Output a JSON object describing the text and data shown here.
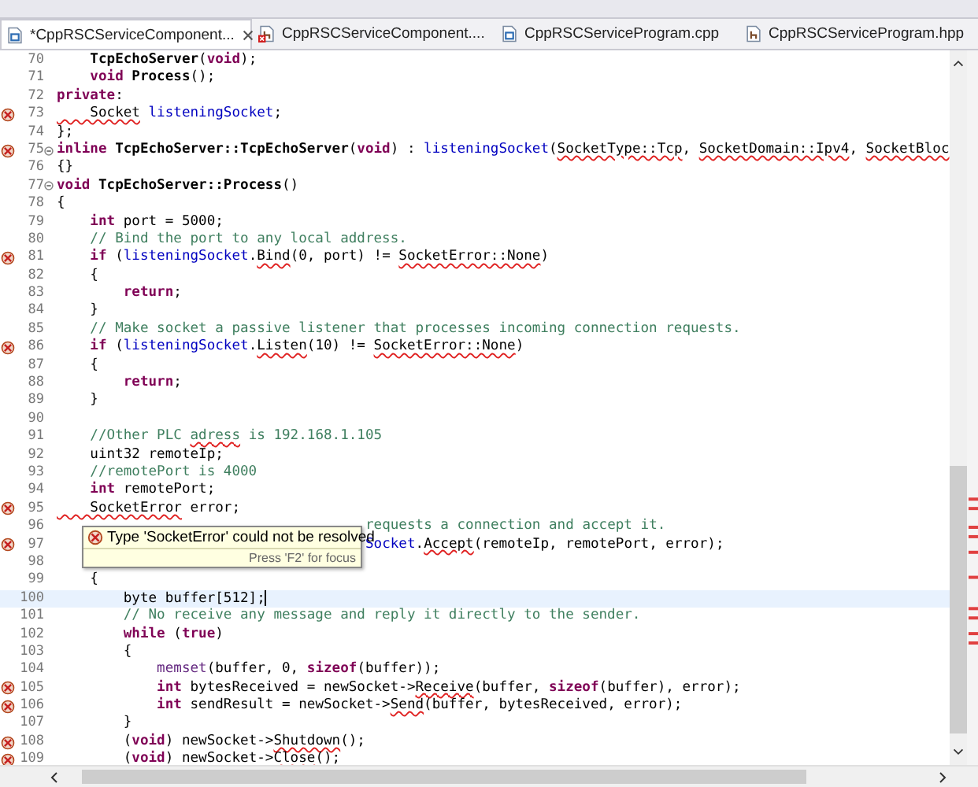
{
  "tabs": [
    {
      "label": "*CppRSCServiceComponent...",
      "kind": "source",
      "error": false,
      "selected": true,
      "closable": true
    },
    {
      "label": "CppRSCServiceComponent....",
      "kind": "header",
      "error": true,
      "selected": false,
      "closable": false
    },
    {
      "label": "CppRSCServiceProgram.cpp",
      "kind": "source",
      "error": false,
      "selected": false,
      "closable": false
    },
    {
      "label": "CppRSCServiceProgram.hpp",
      "kind": "header",
      "error": false,
      "selected": false,
      "closable": false
    }
  ],
  "lines": [
    {
      "number": "70",
      "problem": false,
      "foldable": false,
      "current": false,
      "segments": [
        {
          "text": "    TcpEchoServer",
          "kind": "decl"
        },
        {
          "text": "(",
          "kind": "plain"
        },
        {
          "text": "void",
          "kind": "kw"
        },
        {
          "text": ");",
          "kind": "plain"
        }
      ]
    },
    {
      "number": "71",
      "problem": false,
      "foldable": false,
      "current": false,
      "segments": [
        {
          "text": "    void",
          "kind": "kw"
        },
        {
          "text": " Process",
          "kind": "decl"
        },
        {
          "text": "();",
          "kind": "plain"
        }
      ]
    },
    {
      "number": "72",
      "problem": false,
      "foldable": false,
      "current": false,
      "segments": [
        {
          "text": "private",
          "kind": "kw"
        },
        {
          "text": ":",
          "kind": "plain"
        }
      ]
    },
    {
      "number": "73",
      "problem": true,
      "foldable": false,
      "current": false,
      "segments": [
        {
          "text": "    Socket",
          "kind": "unresolved"
        },
        {
          "text": " listeningSocket",
          "kind": "field"
        },
        {
          "text": ";",
          "kind": "plain"
        }
      ]
    },
    {
      "number": "74",
      "problem": false,
      "foldable": false,
      "current": false,
      "segments": [
        {
          "text": "};",
          "kind": "plain"
        }
      ]
    },
    {
      "number": "75",
      "problem": true,
      "foldable": true,
      "current": false,
      "segments": [
        {
          "text": "inline",
          "kind": "kw"
        },
        {
          "text": " TcpEchoServer::TcpEchoServer",
          "kind": "decl"
        },
        {
          "text": "(",
          "kind": "plain"
        },
        {
          "text": "void",
          "kind": "kw"
        },
        {
          "text": ") : ",
          "kind": "plain"
        },
        {
          "text": "listeningSocket",
          "kind": "field"
        },
        {
          "text": "(",
          "kind": "plain"
        },
        {
          "text": "SocketType::Tcp",
          "kind": "unresolved"
        },
        {
          "text": ", ",
          "kind": "plain"
        },
        {
          "text": "SocketDomain::Ipv4",
          "kind": "unresolved"
        },
        {
          "text": ", ",
          "kind": "plain"
        },
        {
          "text": "SocketBloc",
          "kind": "unresolved"
        }
      ]
    },
    {
      "number": "76",
      "problem": false,
      "foldable": false,
      "current": false,
      "segments": [
        {
          "text": "{}",
          "kind": "plain"
        }
      ]
    },
    {
      "number": "77",
      "problem": false,
      "foldable": true,
      "current": false,
      "segments": [
        {
          "text": "void",
          "kind": "kw"
        },
        {
          "text": " TcpEchoServer::Process",
          "kind": "decl"
        },
        {
          "text": "()",
          "kind": "plain"
        }
      ]
    },
    {
      "number": "78",
      "problem": false,
      "foldable": false,
      "current": false,
      "segments": [
        {
          "text": "{",
          "kind": "plain"
        }
      ]
    },
    {
      "number": "79",
      "problem": false,
      "foldable": false,
      "current": false,
      "segments": [
        {
          "text": "    int",
          "kind": "kw"
        },
        {
          "text": " port = 5000;",
          "kind": "plain"
        }
      ]
    },
    {
      "number": "80",
      "problem": false,
      "foldable": false,
      "current": false,
      "segments": [
        {
          "text": "    // Bind the port to any local address.",
          "kind": "comment"
        }
      ]
    },
    {
      "number": "81",
      "problem": true,
      "foldable": false,
      "current": false,
      "segments": [
        {
          "text": "    if",
          "kind": "kw"
        },
        {
          "text": " (",
          "kind": "plain"
        },
        {
          "text": "listeningSocket",
          "kind": "field"
        },
        {
          "text": ".",
          "kind": "plain"
        },
        {
          "text": "Bind",
          "kind": "unresolved"
        },
        {
          "text": "(0, port) != ",
          "kind": "plain"
        },
        {
          "text": "SocketError::None",
          "kind": "unresolved"
        },
        {
          "text": ")",
          "kind": "plain"
        }
      ]
    },
    {
      "number": "82",
      "problem": false,
      "foldable": false,
      "current": false,
      "segments": [
        {
          "text": "    {",
          "kind": "plain"
        }
      ]
    },
    {
      "number": "83",
      "problem": false,
      "foldable": false,
      "current": false,
      "segments": [
        {
          "text": "        return",
          "kind": "kw"
        },
        {
          "text": ";",
          "kind": "plain"
        }
      ]
    },
    {
      "number": "84",
      "problem": false,
      "foldable": false,
      "current": false,
      "segments": [
        {
          "text": "    }",
          "kind": "plain"
        }
      ]
    },
    {
      "number": "85",
      "problem": false,
      "foldable": false,
      "current": false,
      "segments": [
        {
          "text": "    // Make socket a passive listener that processes incoming connection requests.",
          "kind": "comment"
        }
      ]
    },
    {
      "number": "86",
      "problem": true,
      "foldable": false,
      "current": false,
      "segments": [
        {
          "text": "    if",
          "kind": "kw"
        },
        {
          "text": " (",
          "kind": "plain"
        },
        {
          "text": "listeningSocket",
          "kind": "field"
        },
        {
          "text": ".",
          "kind": "plain"
        },
        {
          "text": "Listen",
          "kind": "unresolved"
        },
        {
          "text": "(10) != ",
          "kind": "plain"
        },
        {
          "text": "SocketError::None",
          "kind": "unresolved"
        },
        {
          "text": ")",
          "kind": "plain"
        }
      ]
    },
    {
      "number": "87",
      "problem": false,
      "foldable": false,
      "current": false,
      "segments": [
        {
          "text": "    {",
          "kind": "plain"
        }
      ]
    },
    {
      "number": "88",
      "problem": false,
      "foldable": false,
      "current": false,
      "segments": [
        {
          "text": "        return",
          "kind": "kw"
        },
        {
          "text": ";",
          "kind": "plain"
        }
      ]
    },
    {
      "number": "89",
      "problem": false,
      "foldable": false,
      "current": false,
      "segments": [
        {
          "text": "    }",
          "kind": "plain"
        }
      ]
    },
    {
      "number": "90",
      "problem": false,
      "foldable": false,
      "current": false
    },
    {
      "number": "91",
      "problem": false,
      "foldable": false,
      "current": false,
      "segments": [
        {
          "text": "    //Other PLC ",
          "kind": "comment"
        },
        {
          "text": "adress",
          "kind": "misspelled"
        },
        {
          "text": " is 192.168.1.105",
          "kind": "comment"
        }
      ]
    },
    {
      "number": "92",
      "problem": false,
      "foldable": false,
      "current": false,
      "segments": [
        {
          "text": "    uint32 remoteIp;",
          "kind": "plain"
        }
      ]
    },
    {
      "number": "93",
      "problem": false,
      "foldable": false,
      "current": false,
      "segments": [
        {
          "text": "    //remotePort is 4000",
          "kind": "comment"
        }
      ]
    },
    {
      "number": "94",
      "problem": false,
      "foldable": false,
      "current": false,
      "segments": [
        {
          "text": "    int",
          "kind": "kw"
        },
        {
          "text": " remotePort;",
          "kind": "plain"
        }
      ]
    },
    {
      "number": "95",
      "problem": true,
      "foldable": false,
      "current": false,
      "segments": [
        {
          "text": "    SocketError",
          "kind": "unresolved"
        },
        {
          "text": " error;",
          "kind": "plain"
        }
      ]
    },
    {
      "number": "96",
      "problem": false,
      "foldable": false,
      "current": false,
      "covered": true,
      "segments": [
        {
          "text": "requests a connection and accept it.",
          "kind": "comment"
        }
      ]
    },
    {
      "number": "97",
      "problem": true,
      "foldable": false,
      "current": false,
      "covered": true,
      "segments": [
        {
          "text": "Socket",
          "kind": "field"
        },
        {
          "text": ".",
          "kind": "plain"
        },
        {
          "text": "Accept",
          "kind": "unresolved"
        },
        {
          "text": "(remoteIp, remotePort, error);",
          "kind": "plain"
        }
      ]
    },
    {
      "number": "98",
      "problem": false,
      "foldable": false,
      "current": false
    },
    {
      "number": "99",
      "problem": false,
      "foldable": false,
      "current": false,
      "segments": [
        {
          "text": "    {",
          "kind": "plain"
        }
      ]
    },
    {
      "number": "100",
      "problem": false,
      "foldable": false,
      "current": true,
      "segments": [
        {
          "text": "        byte buffer[512];",
          "kind": "plain"
        }
      ]
    },
    {
      "number": "101",
      "problem": false,
      "foldable": false,
      "current": false,
      "segments": [
        {
          "text": "        // No receive any message and reply it directly to the sender.",
          "kind": "comment"
        }
      ]
    },
    {
      "number": "102",
      "problem": false,
      "foldable": false,
      "current": false,
      "segments": [
        {
          "text": "        while",
          "kind": "kw"
        },
        {
          "text": " (",
          "kind": "plain"
        },
        {
          "text": "true",
          "kind": "kw"
        },
        {
          "text": ")",
          "kind": "plain"
        }
      ]
    },
    {
      "number": "103",
      "problem": false,
      "foldable": false,
      "current": false,
      "segments": [
        {
          "text": "        {",
          "kind": "plain"
        }
      ]
    },
    {
      "number": "104",
      "problem": false,
      "foldable": false,
      "current": false,
      "segments": [
        {
          "text": "            memset",
          "kind": "func"
        },
        {
          "text": "(buffer, 0, ",
          "kind": "plain"
        },
        {
          "text": "sizeof",
          "kind": "kw"
        },
        {
          "text": "(buffer));",
          "kind": "plain"
        }
      ]
    },
    {
      "number": "105",
      "problem": true,
      "foldable": false,
      "current": false,
      "segments": [
        {
          "text": "            int",
          "kind": "kw"
        },
        {
          "text": " bytesReceived = newSocket->",
          "kind": "plain"
        },
        {
          "text": "Receive",
          "kind": "unresolved"
        },
        {
          "text": "(buffer, ",
          "kind": "plain"
        },
        {
          "text": "sizeof",
          "kind": "kw"
        },
        {
          "text": "(buffer), error);",
          "kind": "plain"
        }
      ]
    },
    {
      "number": "106",
      "problem": true,
      "foldable": false,
      "current": false,
      "segments": [
        {
          "text": "            int",
          "kind": "kw"
        },
        {
          "text": " sendResult = newSocket->",
          "kind": "plain"
        },
        {
          "text": "Send",
          "kind": "unresolved"
        },
        {
          "text": "(buffer, bytesReceived, error);",
          "kind": "plain"
        }
      ]
    },
    {
      "number": "107",
      "problem": false,
      "foldable": false,
      "current": false,
      "segments": [
        {
          "text": "        }",
          "kind": "plain"
        }
      ]
    },
    {
      "number": "108",
      "problem": true,
      "foldable": false,
      "current": false,
      "segments": [
        {
          "text": "        (",
          "kind": "plain"
        },
        {
          "text": "void",
          "kind": "kw"
        },
        {
          "text": ") newSocket->",
          "kind": "plain"
        },
        {
          "text": "Shutdown",
          "kind": "unresolved"
        },
        {
          "text": "();",
          "kind": "plain"
        }
      ]
    },
    {
      "number": "109",
      "problem": true,
      "foldable": false,
      "current": false,
      "segments": [
        {
          "text": "        (",
          "kind": "plain"
        },
        {
          "text": "void",
          "kind": "kw"
        },
        {
          "text": ") newSocket->",
          "kind": "plain"
        },
        {
          "text": "Close",
          "kind": "unresolved"
        },
        {
          "text": "();",
          "kind": "plain"
        }
      ]
    }
  ],
  "tooltip": {
    "message": "Type 'SocketError' could not be resolved",
    "hint": "Press 'F2' for focus"
  }
}
